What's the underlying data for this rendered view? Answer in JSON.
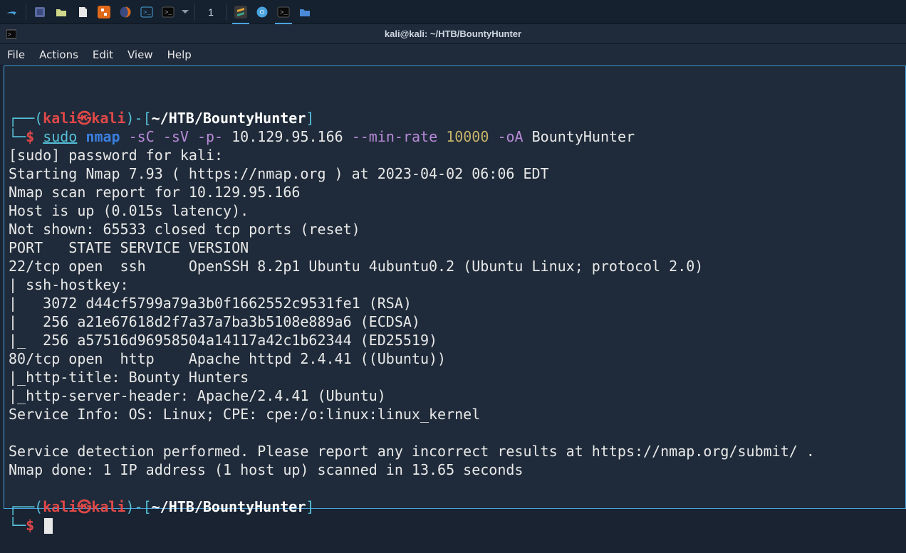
{
  "taskbar": {
    "icons": [
      {
        "name": "kali-menu-icon",
        "color": "#4aa3df"
      },
      {
        "name": "activity-icon",
        "color": "#6a7aa8"
      },
      {
        "name": "files-icon",
        "color": "#d8d8a8"
      },
      {
        "name": "editor-icon",
        "color": "#e8e8e8"
      },
      {
        "name": "burpsuite-icon",
        "color": "#e06a1a"
      },
      {
        "name": "firefox-icon",
        "color": "#e06a1a"
      },
      {
        "name": "terminal-icon",
        "color": "#4aa3df"
      },
      {
        "name": "qterminal-icon",
        "color": "#2a2a2a"
      },
      {
        "name": "dropdown-icon",
        "color": "#8a98a8"
      }
    ],
    "workspace": "1",
    "right": [
      {
        "name": "sublime-icon",
        "color": "#3aa88a"
      },
      {
        "name": "chromium-icon",
        "color": "#4aa3df"
      },
      {
        "name": "terminal2-icon",
        "color": "#2a2a2a"
      },
      {
        "name": "folder-icon",
        "color": "#4a8ad8"
      }
    ]
  },
  "window": {
    "title": "kali@kali: ~/HTB/BountyHunter"
  },
  "menubar": [
    "File",
    "Actions",
    "Edit",
    "View",
    "Help"
  ],
  "prompt": {
    "user": "kali",
    "host": "kali",
    "sep": "㉿",
    "cwd": "~/HTB/BountyHunter",
    "symbol": "$"
  },
  "cmd": {
    "sudo": "sudo",
    "bin": "nmap",
    "args_pre": "-sC -sV -p-",
    "target": "10.129.95.166",
    "rate_flag": "--min-rate",
    "rate_val": "10000",
    "oa_flag": "-oA",
    "oa_val": "BountyHunter"
  },
  "out": {
    "l1": "[sudo] password for kali: ",
    "l2": "Starting Nmap 7.93 ( https://nmap.org ) at 2023-04-02 06:06 EDT",
    "l3": "Nmap scan report for 10.129.95.166",
    "l4": "Host is up (0.015s latency).",
    "l5": "Not shown: 65533 closed tcp ports (reset)",
    "l6": "PORT   STATE SERVICE VERSION",
    "l7": "22/tcp open  ssh     OpenSSH 8.2p1 Ubuntu 4ubuntu0.2 (Ubuntu Linux; protocol 2.0)",
    "l8": "| ssh-hostkey: ",
    "l9": "|   3072 d44cf5799a79a3b0f1662552c9531fe1 (RSA)",
    "l10": "|   256 a21e67618d2f7a37a7ba3b5108e889a6 (ECDSA)",
    "l11": "|_  256 a57516d96958504a14117a42c1b62344 (ED25519)",
    "l12": "80/tcp open  http    Apache httpd 2.4.41 ((Ubuntu))",
    "l13": "|_http-title: Bounty Hunters",
    "l14": "|_http-server-header: Apache/2.4.41 (Ubuntu)",
    "l15": "Service Info: OS: Linux; CPE: cpe:/o:linux:linux_kernel",
    "l16": "",
    "l17": "Service detection performed. Please report any incorrect results at https://nmap.org/submit/ .",
    "l18": "Nmap done: 1 IP address (1 host up) scanned in 13.65 seconds"
  }
}
